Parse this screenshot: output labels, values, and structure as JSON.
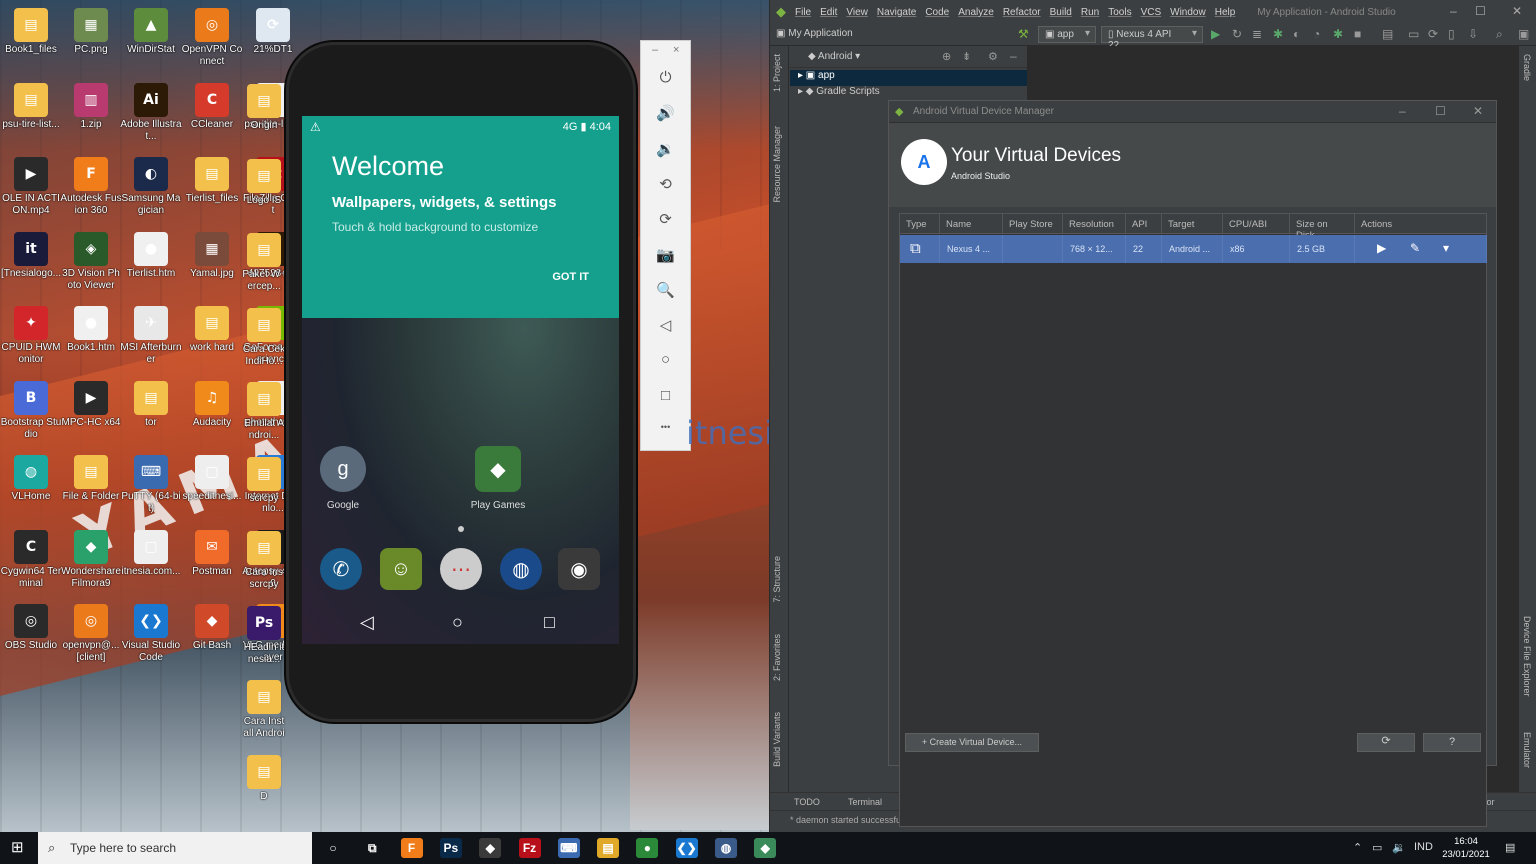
{
  "desktop": {
    "icons": [
      {
        "label": "Book1_files",
        "color": "#f3c14b",
        "glyph": "▤"
      },
      {
        "label": "PC.png",
        "color": "#6d8b4f",
        "glyph": "▦"
      },
      {
        "label": "WinDirStat",
        "color": "#5d8c3c",
        "glyph": "▲"
      },
      {
        "label": "OpenVPN Connect",
        "color": "#ea7a1a",
        "glyph": "◎"
      },
      {
        "label": "21%DT1",
        "color": "#dfe7f1",
        "glyph": "⟳"
      },
      {
        "label": "psu-tire-list...",
        "color": "#f3c14b",
        "glyph": "▤"
      },
      {
        "label": "1.zip",
        "color": "#b83a6e",
        "glyph": "▥"
      },
      {
        "label": "Adobe Illustrat...",
        "color": "#2c1a06",
        "glyph": "Ai"
      },
      {
        "label": "CCleaner",
        "color": "#d63a2a",
        "glyph": "C"
      },
      {
        "label": "psu-tire-list...",
        "color": "#f0f0f0",
        "glyph": "●"
      },
      {
        "label": "OLE IN ACTION.mp4",
        "color": "#2a2a2a",
        "glyph": "▶"
      },
      {
        "label": "Autodesk Fusion 360",
        "color": "#f07d1a",
        "glyph": "F"
      },
      {
        "label": "Samsung Magician",
        "color": "#1b2a4a",
        "glyph": "◐"
      },
      {
        "label": "Tierlist_files",
        "color": "#f3c14b",
        "glyph": "▤"
      },
      {
        "label": "FileZilla Client",
        "color": "#b8101a",
        "glyph": "Fz"
      },
      {
        "label": "[Tnesialogo...",
        "color": "#1a1a3a",
        "glyph": "it"
      },
      {
        "label": "3D Vision Photo Viewer",
        "color": "#2a5a2a",
        "glyph": "◈"
      },
      {
        "label": "Tierlist.htm",
        "color": "#f0f0f0",
        "glyph": "●"
      },
      {
        "label": "Yamal.jpg",
        "color": "#7a4a3a",
        "glyph": "▦"
      },
      {
        "label": "487528-P...",
        "color": "#2c1a06",
        "glyph": "Ai"
      },
      {
        "label": "CPUID HWMonitor",
        "color": "#d2262a",
        "glyph": "✦"
      },
      {
        "label": "Book1.htm",
        "color": "#f0f0f0",
        "glyph": "●"
      },
      {
        "label": "MSI Afterburner",
        "color": "#e8e8e8",
        "glyph": "✈"
      },
      {
        "label": "work hard",
        "color": "#f3c14b",
        "glyph": "▤"
      },
      {
        "label": "GeForce Experience",
        "color": "#76b900",
        "glyph": "◉"
      },
      {
        "label": "Bootstrap Studio",
        "color": "#4a6ad8",
        "glyph": "B"
      },
      {
        "label": "MPC-HC x64",
        "color": "#2a2a2a",
        "glyph": "▶"
      },
      {
        "label": "tor",
        "color": "#f3c14b",
        "glyph": "▤"
      },
      {
        "label": "Audacity",
        "color": "#f08a1a",
        "glyph": "♫"
      },
      {
        "label": "photothum...",
        "color": "#eeeeee",
        "glyph": "▢"
      },
      {
        "label": "VLHome",
        "color": "#1aa8a0",
        "glyph": "◍"
      },
      {
        "label": "File & Folder",
        "color": "#f3c14b",
        "glyph": "▤"
      },
      {
        "label": "PuTTY (64-bit)",
        "color": "#3a6ab0",
        "glyph": "⌨"
      },
      {
        "label": "speeditnesi...",
        "color": "#eeeeee",
        "glyph": "▢"
      },
      {
        "label": "Internet Downlo...",
        "color": "#2a7ad8",
        "glyph": "⇩"
      },
      {
        "label": "Cygwin64 Terminal",
        "color": "#2a2a2a",
        "glyph": "C"
      },
      {
        "label": "Wondershare Filmora9",
        "color": "#2aa06a",
        "glyph": "◆"
      },
      {
        "label": "itnesia.com...",
        "color": "#eeeeee",
        "glyph": "▢"
      },
      {
        "label": "Postman",
        "color": "#f06a2a",
        "glyph": "✉"
      },
      {
        "label": "Autopsy 4.17.0",
        "color": "#1a1a1a",
        "glyph": "☻"
      },
      {
        "label": "OBS Studio",
        "color": "#2a2a2a",
        "glyph": "◎"
      },
      {
        "label": "openvpn@... [client]",
        "color": "#ea7a1a",
        "glyph": "◎"
      },
      {
        "label": "Visual Studio Code",
        "color": "#1a78d0",
        "glyph": "❮❯"
      },
      {
        "label": "Git Bash",
        "color": "#d04a2a",
        "glyph": "◆"
      },
      {
        "label": "VLC media player",
        "color": "#f08a1a",
        "glyph": "▲"
      }
    ],
    "extra_icons": [
      {
        "label": "Origin",
        "color": "#f3c14b",
        "glyph": "▤"
      },
      {
        "label": "Logo IS",
        "color": "#f3c14b",
        "glyph": "▤"
      },
      {
        "label": "Paket W tercep...",
        "color": "#f3c14b",
        "glyph": "▤"
      },
      {
        "label": "Cara Cek IndiHo...",
        "color": "#f3c14b",
        "glyph": "▤"
      },
      {
        "label": "Emulat Androi...",
        "color": "#f3c14b",
        "glyph": "▤"
      },
      {
        "label": "scrcpy",
        "color": "#f3c14b",
        "glyph": "▤"
      },
      {
        "label": "Cara Ins scrcpy W...",
        "color": "#f3c14b",
        "glyph": "▤"
      },
      {
        "label": "HEadin itnesia...",
        "color": "#3a1a6a",
        "glyph": "Ps"
      },
      {
        "label": "Cara Install Android S...",
        "color": "#f3c14b",
        "glyph": "▤"
      },
      {
        "label": "D",
        "color": "#f3c14b",
        "glyph": "▤"
      }
    ],
    "wallpaper_text": "YAMAL",
    "watermark": "itnesia.com"
  },
  "emulator": {
    "status_time": "4:04",
    "status_signal": "4G ▮",
    "welcome": {
      "title": "Welcome",
      "subtitle": "Wallpapers, widgets, & settings",
      "hint": "Touch & hold background to customize",
      "button": "GOT IT"
    },
    "home_icons": [
      {
        "label": "Google",
        "glyph": "g",
        "color": "#5a6a7a"
      },
      {
        "label": "Play Games",
        "glyph": "◆",
        "color": "#3a7a3a"
      }
    ],
    "dock": [
      {
        "name": "phone",
        "glyph": "✆",
        "color": "#1a5a8a"
      },
      {
        "name": "messaging",
        "glyph": "☺",
        "color": "#6a8a2a"
      },
      {
        "name": "app-drawer",
        "glyph": "⋯",
        "color": "#cccccc"
      },
      {
        "name": "browser",
        "glyph": "◍",
        "color": "#1a4a8a"
      },
      {
        "name": "camera",
        "glyph": "◉",
        "color": "#3a3a3a"
      }
    ],
    "nav": {
      "back": "◁",
      "home": "○",
      "recents": "□"
    },
    "toolbar": {
      "minimize": "–",
      "close": "×",
      "items": [
        {
          "name": "power",
          "glyph": "⏻"
        },
        {
          "name": "volume-up",
          "glyph": "🔊"
        },
        {
          "name": "volume-down",
          "glyph": "🔉"
        },
        {
          "name": "rotate-left",
          "glyph": "⟲"
        },
        {
          "name": "rotate-right",
          "glyph": "⟳"
        },
        {
          "name": "screenshot",
          "glyph": "📷"
        },
        {
          "name": "zoom",
          "glyph": "🔍"
        },
        {
          "name": "back",
          "glyph": "◁"
        },
        {
          "name": "home",
          "glyph": "○"
        },
        {
          "name": "overview",
          "glyph": "□"
        },
        {
          "name": "more",
          "glyph": "•••"
        }
      ]
    }
  },
  "studio": {
    "menu": [
      "File",
      "Edit",
      "View",
      "Navigate",
      "Code",
      "Analyze",
      "Refactor",
      "Build",
      "Run",
      "Tools",
      "VCS",
      "Window",
      "Help"
    ],
    "window_title": "My Application - Android Studio",
    "project_name": "My Application",
    "run_config": "app",
    "device": "Nexus 4 API 22",
    "project_view": "Android",
    "tree": [
      {
        "label": "app",
        "selected": true
      },
      {
        "label": "Gradle Scripts",
        "selected": false
      }
    ],
    "left_tabs": [
      "1: Project",
      "Resource Manager",
      "7: Structure",
      "2: Favorites",
      "Build Variants"
    ],
    "right_tabs": [
      "Gradle",
      "Device File Explorer",
      "Emulator"
    ],
    "bottom_tabs": [
      "TODO",
      "Terminal",
      "Database Inspector",
      "Profiler",
      "6: Logcat"
    ],
    "bottom_right_tabs": [
      "Event Log",
      "Layout Inspector"
    ],
    "status": "* daemon started successfully (today 14:50)"
  },
  "avd": {
    "window_title": "Android Virtual Device Manager",
    "heading": "Your Virtual Devices",
    "subheading": "Android Studio",
    "columns": [
      "Type",
      "Name",
      "Play Store",
      "Resolution",
      "API",
      "Target",
      "CPU/ABI",
      "Size on Disk",
      "Actions"
    ],
    "rows": [
      {
        "type": "⧉",
        "name": "Nexus 4 ...",
        "play_store": "",
        "resolution": "768 × 12...",
        "api": "22",
        "target": "Android ...",
        "cpu": "x86",
        "size": "2.5 GB",
        "actions": [
          "▶",
          "✎",
          "▾"
        ]
      }
    ],
    "create_button": "+ Create Virtual Device...",
    "refresh_button": "⟳",
    "help_button": "?"
  },
  "taskbar": {
    "search_placeholder": "Type here to search",
    "apps": [
      {
        "name": "cortana",
        "glyph": "○",
        "color": "#101418"
      },
      {
        "name": "task-view",
        "glyph": "⧉",
        "color": "#101418"
      },
      {
        "name": "fusion",
        "glyph": "F",
        "color": "#f07d1a"
      },
      {
        "name": "photoshop",
        "glyph": "Ps",
        "color": "#0a2a4a"
      },
      {
        "name": "app-3",
        "glyph": "◆",
        "color": "#3a3a3a"
      },
      {
        "name": "filezilla",
        "glyph": "Fz",
        "color": "#b8101a"
      },
      {
        "name": "network",
        "glyph": "⌨",
        "color": "#3a6ab0"
      },
      {
        "name": "explorer",
        "glyph": "▤",
        "color": "#e0a92a"
      },
      {
        "name": "chrome",
        "glyph": "●",
        "color": "#2a8a3a"
      },
      {
        "name": "vscode",
        "glyph": "❮❯",
        "color": "#1a78d0"
      },
      {
        "name": "app-10",
        "glyph": "◍",
        "color": "#3a5a8a"
      },
      {
        "name": "android-studio",
        "glyph": "◆",
        "color": "#3a8a5a"
      }
    ],
    "language": "IND",
    "time": "16:04",
    "date": "23/01/2021"
  }
}
